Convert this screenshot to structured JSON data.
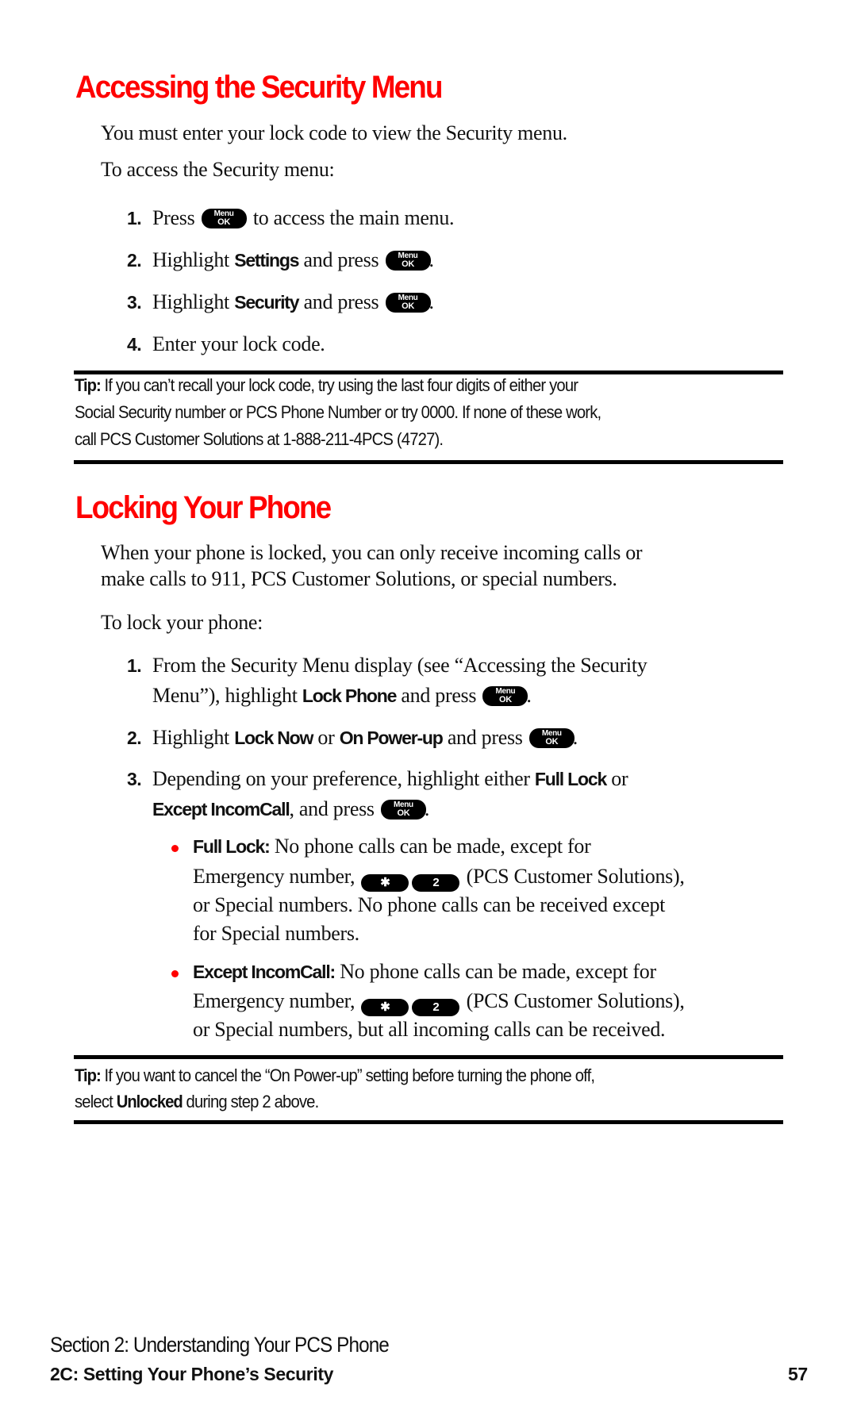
{
  "section1": {
    "title": "Accessing the Security Menu",
    "intro": "You must enter your lock code to view the Security menu.",
    "lead": "To access the Security menu:",
    "steps": [
      {
        "num": "1.",
        "pre": "Press",
        "post": "to access the main menu."
      },
      {
        "num": "2.",
        "pre": "Highlight",
        "bold": "Settings",
        "mid": "and press",
        "post": "."
      },
      {
        "num": "3.",
        "pre": "Highlight",
        "bold": "Security",
        "mid": "and press",
        "post": "."
      },
      {
        "num": "4.",
        "pre": "Enter your lock code."
      }
    ],
    "tip": {
      "label": "Tip:",
      "lines": [
        "If you can’t recall your lock code, try using the last four digits of either your",
        "Social Security number or PCS Phone Number or try 0000. If none of these work,",
        "call PCS Customer Solutions at 1-888-211-4PCS (4727)."
      ]
    }
  },
  "section2": {
    "title": "Locking Your Phone",
    "intro_lines": [
      "When your phone is locked, you can only receive incoming calls or",
      "make calls to 911, PCS Customer Solutions, or special numbers."
    ],
    "lead": "To lock your phone:",
    "step1": {
      "num": "1.",
      "line1": "From the Security Menu display (see “Accessing the Security",
      "line2_pre": "Menu”), highlight",
      "bold": "Lock Phone",
      "line2_mid": "and press",
      "post": "."
    },
    "step2": {
      "num": "2.",
      "pre": "Highlight",
      "bold1": "Lock Now",
      "or": "or",
      "bold2": "On Power-up",
      "mid": "and press",
      "post": "."
    },
    "step3": {
      "num": "3.",
      "line1": "Depending on your preference, highlight either",
      "bold1": "Full Lock",
      "or": "or",
      "bold2": "Except IncomCall",
      "line2_mid": ", and press",
      "post": "."
    },
    "bullets": [
      {
        "label": "Full Lock:",
        "line1": "No phone calls can be made, except for",
        "line2_pre": "Emergency number,",
        "line2_post": "(PCS Customer Solutions),",
        "line3": "or Special numbers. No phone calls can be received except",
        "line4": "for Special numbers."
      },
      {
        "label": "Except IncomCall:",
        "line1": "No phone calls can be made, except for",
        "line2_pre": "Emergency number,",
        "line2_post": "(PCS Customer Solutions),",
        "line3": "or Special numbers, but all incoming calls can be received."
      }
    ],
    "tip": {
      "label": "Tip:",
      "line1": "If you want to cancel the “On Power-up” setting before turning the phone off,",
      "line2_pre": "select",
      "line2_bold": "Unlocked",
      "line2_post": "during step 2 above."
    }
  },
  "keys": {
    "menu_top": "Menu",
    "menu_bottom": "OK",
    "star": "✱",
    "two": "2"
  },
  "footer": {
    "section": "Section 2: Understanding Your PCS Phone",
    "chapter": "2C: Setting Your Phone’s Security",
    "page": "57"
  },
  "colors": {
    "heading": "#ff0000",
    "bullet": "#ff0000",
    "rule": "#000000"
  }
}
